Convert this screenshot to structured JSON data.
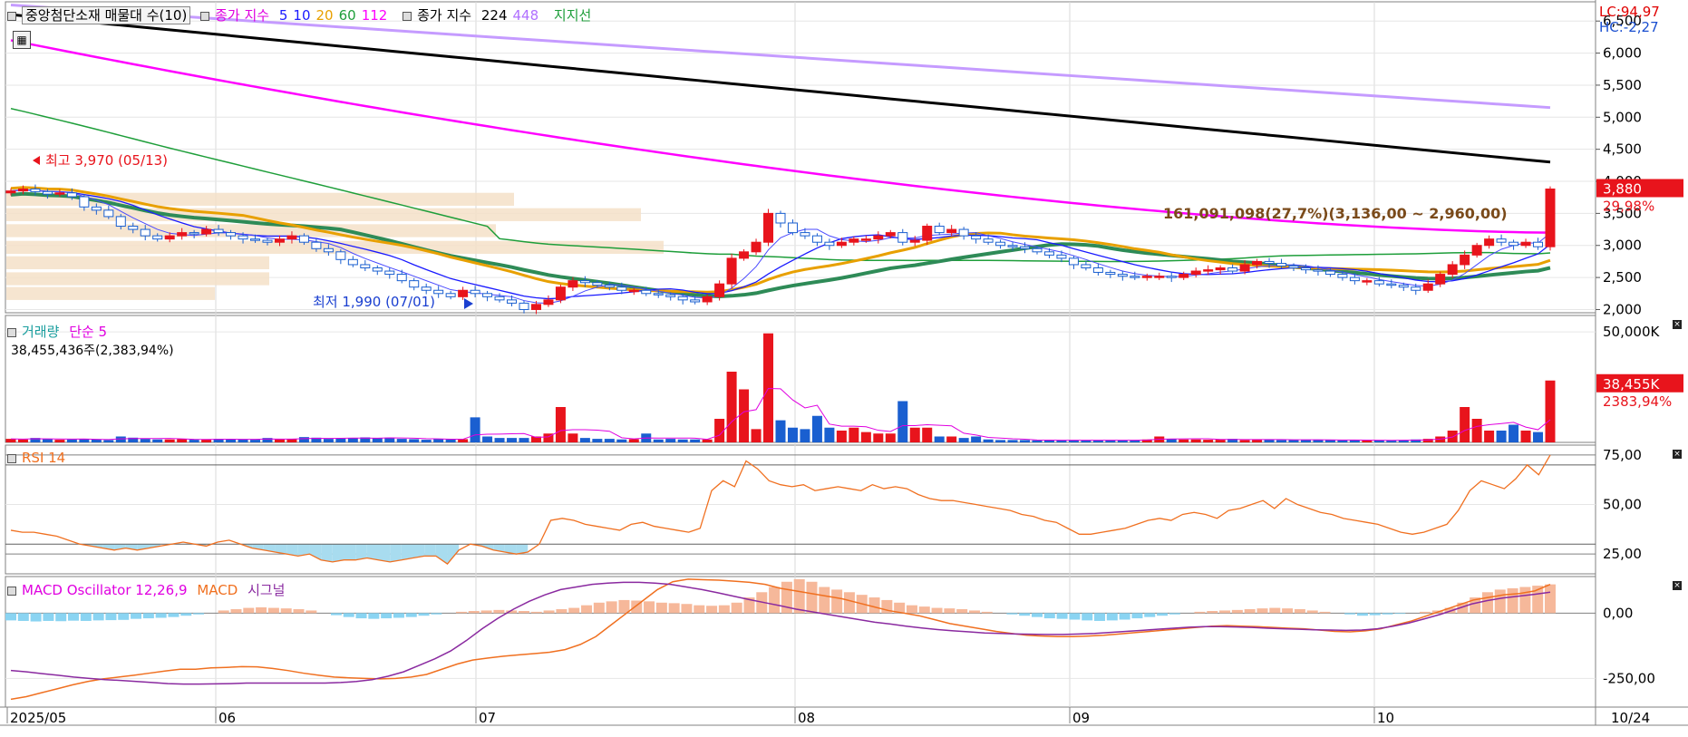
{
  "main_legend": {
    "title": "중앙첨단소재 매물대 수(10)",
    "ma_label": "종가 지수",
    "ma_periods": [
      "5",
      "10",
      "20",
      "60",
      "112"
    ],
    "ma_colors": [
      "#1a1aff",
      "#1a1aff",
      "#e8a000",
      "#1e9e3a",
      "#ff00ff"
    ],
    "ma2_label": "종가 지수",
    "ma2_periods": [
      "224",
      "448"
    ],
    "ma2_colors": [
      "#000000",
      "#b070ff"
    ],
    "support_label": "지지선",
    "lc": "LC:94,97",
    "hc": "HC:-2,27"
  },
  "volume_legend": {
    "label": "거래량",
    "ma_label": "단순 5",
    "value": "38,455,436주(2,383,94%)"
  },
  "rsi_legend": {
    "label": "RSI 14"
  },
  "macd_legend": {
    "osc": "MACD Oscillator 12,26,9",
    "macd": "MACD",
    "signal": "시그널"
  },
  "price_tag": {
    "price": "3,880",
    "pct": "29,98%"
  },
  "volume_tag": {
    "value": "38,455K",
    "pct": "2383,94%"
  },
  "annotations": {
    "high": "최고 3,970 (05/13)",
    "low": "최저 1,990 (07/01)",
    "range_note": "161,091,098(27,7%)(3,136,00 ~ 2,960,00)"
  },
  "x_labels": [
    "2025/05",
    "06",
    "07",
    "08",
    "09",
    "10",
    "10/24"
  ],
  "chart_data": [
    {
      "type": "candlestick",
      "panel": "price",
      "ylim": [
        1950,
        6800
      ],
      "yticks": [
        "2,000",
        "2,500",
        "3,000",
        "3,500",
        "4,000",
        "4,500",
        "5,000",
        "5,500",
        "6,000",
        "6,500"
      ],
      "ytick_values": [
        2000,
        2500,
        3000,
        3500,
        4000,
        4500,
        5000,
        5500,
        6000,
        6500
      ],
      "closes": [
        3850,
        3880,
        3840,
        3800,
        3820,
        3760,
        3600,
        3550,
        3450,
        3300,
        3250,
        3150,
        3100,
        3150,
        3200,
        3180,
        3250,
        3200,
        3150,
        3100,
        3080,
        3050,
        3100,
        3150,
        3050,
        2950,
        2900,
        2780,
        2700,
        2650,
        2600,
        2550,
        2450,
        2350,
        2300,
        2250,
        2200,
        2300,
        2250,
        2200,
        2150,
        2100,
        2000,
        2080,
        2150,
        2350,
        2450,
        2420,
        2380,
        2350,
        2300,
        2300,
        2250,
        2230,
        2200,
        2150,
        2120,
        2200,
        2400,
        2800,
        2900,
        3050,
        3500,
        3350,
        3200,
        3150,
        3050,
        3000,
        3050,
        3100,
        3100,
        3150,
        3200,
        3050,
        3080,
        3300,
        3200,
        3250,
        3150,
        3100,
        3050,
        3000,
        2980,
        2950,
        2900,
        2850,
        2800,
        2700,
        2650,
        2580,
        2550,
        2520,
        2500,
        2520,
        2520,
        2500,
        2550,
        2600,
        2620,
        2650,
        2600,
        2700,
        2750,
        2720,
        2680,
        2650,
        2620,
        2600,
        2550,
        2500,
        2450,
        2450,
        2400,
        2380,
        2350,
        2300,
        2400,
        2550,
        2700,
        2850,
        3000,
        3100,
        3050,
        3000,
        3050,
        2980,
        3880
      ],
      "volume_k": [
        1.2,
        1.0,
        1.5,
        1.1,
        0.9,
        1.0,
        1.2,
        1.0,
        0.8,
        2.0,
        1.6,
        1.2,
        1.0,
        1.0,
        1.1,
        0.9,
        1.0,
        1.2,
        1.1,
        1.0,
        0.9,
        1.5,
        1.0,
        1.1,
        1.8,
        1.6,
        1.2,
        1.3,
        1.5,
        1.7,
        1.5,
        1.6,
        1.2,
        1.1,
        0.9,
        1.2,
        1.0,
        1.1,
        8.5,
        2.0,
        1.5,
        1.5,
        1.5,
        2.0,
        3.0,
        12.0,
        3.0,
        1.5,
        1.2,
        1.2,
        1.0,
        1.1,
        3.0,
        1.0,
        1.2,
        1.0,
        1.0,
        1.0,
        8.0,
        24.0,
        18.0,
        4.5,
        37.0,
        7.5,
        5.0,
        4.5,
        9.0,
        5.0,
        4.0,
        5.0,
        3.5,
        3.0,
        3.0,
        14.0,
        5.0,
        5.0,
        2.0,
        2.0,
        1.5,
        2.0,
        1.0,
        0.8,
        0.8,
        0.8,
        0.7,
        0.7,
        0.7,
        0.8,
        0.7,
        0.7,
        0.8,
        0.7,
        0.8,
        1.0,
        2.0,
        1.2,
        1.0,
        1.0,
        0.9,
        0.9,
        1.2,
        0.8,
        1.0,
        1.0,
        0.8,
        0.9,
        0.8,
        0.9,
        0.8,
        0.7,
        0.8,
        0.7,
        0.7,
        0.6,
        0.8,
        1.0,
        1.2,
        2.0,
        4.0,
        12.0,
        8.0,
        4.0,
        4.0,
        6.0,
        4.0,
        3.5,
        21.0
      ],
      "ma224": [
        6600,
        4300
      ],
      "ma448": [
        6750,
        5150
      ],
      "ma112": [
        6200,
        3200
      ]
    },
    {
      "type": "bar",
      "panel": "volume",
      "yticks": [
        "50,000K"
      ],
      "ytick_values": [
        50000
      ]
    },
    {
      "type": "line",
      "panel": "rsi",
      "ylim": [
        15,
        80
      ],
      "yticks": [
        "25,00",
        "50,00",
        "75,00"
      ],
      "ytick_values": [
        25,
        50,
        75
      ],
      "values": [
        37,
        36,
        36,
        35,
        34,
        32,
        30,
        29,
        28,
        27,
        28,
        27,
        28,
        29,
        30,
        31,
        30,
        29,
        31,
        32,
        30,
        28,
        27,
        26,
        25,
        24,
        25,
        22,
        21,
        22,
        22,
        23,
        22,
        21,
        22,
        23,
        24,
        24,
        20,
        27,
        30,
        29,
        27,
        26,
        25,
        26,
        30,
        42,
        43,
        42,
        40,
        39,
        38,
        37,
        40,
        41,
        39,
        38,
        37,
        36,
        38,
        57,
        62,
        59,
        72,
        68,
        62,
        60,
        59,
        60,
        57,
        58,
        59,
        58,
        57,
        60,
        58,
        59,
        58,
        55,
        53,
        52,
        52,
        51,
        50,
        49,
        48,
        47,
        45,
        44,
        42,
        41,
        38,
        35,
        35,
        36,
        37,
        38,
        40,
        42,
        43,
        42,
        45,
        46,
        45,
        43,
        47,
        48,
        50,
        52,
        48,
        53,
        50,
        48,
        46,
        45,
        43,
        42,
        41,
        40,
        38,
        36,
        35,
        36,
        38,
        40,
        47,
        57,
        62,
        60,
        58,
        63,
        70,
        65,
        75
      ]
    },
    {
      "type": "bar",
      "panel": "macd",
      "ylim": [
        -360,
        140
      ],
      "yticks": [
        "-250,00",
        "0,00"
      ],
      "ytick_values": [
        -250,
        0
      ],
      "oscillator": [
        -28,
        -30,
        -32,
        -30,
        -31,
        -29,
        -30,
        -28,
        -27,
        -26,
        -22,
        -20,
        -18,
        -15,
        -10,
        -5,
        0,
        10,
        15,
        20,
        22,
        20,
        18,
        15,
        10,
        0,
        -8,
        -15,
        -20,
        -22,
        -20,
        -18,
        -15,
        -10,
        -5,
        0,
        5,
        8,
        10,
        12,
        10,
        8,
        5,
        10,
        15,
        20,
        30,
        40,
        45,
        50,
        48,
        45,
        40,
        38,
        35,
        30,
        28,
        30,
        40,
        60,
        80,
        100,
        120,
        130,
        120,
        100,
        90,
        80,
        70,
        60,
        50,
        40,
        30,
        25,
        20,
        18,
        15,
        10,
        5,
        0,
        -5,
        -10,
        -15,
        -20,
        -22,
        -25,
        -28,
        -30,
        -28,
        -25,
        -20,
        -15,
        -10,
        -5,
        0,
        5,
        8,
        10,
        12,
        15,
        18,
        20,
        18,
        15,
        10,
        5,
        0,
        -5,
        -10,
        -8,
        -5,
        -3,
        0,
        5,
        10,
        20,
        40,
        60,
        80,
        90,
        95,
        100,
        105,
        110
      ],
      "macd": [
        -330,
        -320,
        -305,
        -290,
        -275,
        -262,
        -252,
        -245,
        -238,
        -230,
        -222,
        -215,
        -215,
        -210,
        -208,
        -205,
        -206,
        -212,
        -220,
        -230,
        -238,
        -245,
        -248,
        -250,
        -252,
        -250,
        -245,
        -235,
        -215,
        -195,
        -180,
        -172,
        -165,
        -160,
        -155,
        -150,
        -140,
        -120,
        -90,
        -45,
        0,
        45,
        90,
        120,
        130,
        128,
        126,
        122,
        118,
        110,
        95,
        85,
        75,
        65,
        55,
        40,
        25,
        10,
        0,
        -10,
        -25,
        -40,
        -50,
        -60,
        -70,
        -78,
        -85,
        -88,
        -90,
        -90,
        -88,
        -85,
        -80,
        -75,
        -70,
        -65,
        -60,
        -55,
        -50,
        -48,
        -50,
        -52,
        -55,
        -58,
        -60,
        -65,
        -70,
        -72,
        -68,
        -60,
        -45,
        -30,
        -10,
        10,
        30,
        50,
        60,
        70,
        75,
        85,
        110
      ],
      "signal": [
        -220,
        -225,
        -232,
        -238,
        -245,
        -250,
        -255,
        -258,
        -262,
        -266,
        -270,
        -272,
        -272,
        -271,
        -270,
        -268,
        -268,
        -268,
        -268,
        -268,
        -268,
        -266,
        -262,
        -255,
        -242,
        -225,
        -200,
        -175,
        -145,
        -105,
        -60,
        -20,
        15,
        45,
        70,
        90,
        100,
        110,
        115,
        118,
        118,
        115,
        110,
        100,
        90,
        78,
        65,
        52,
        40,
        28,
        15,
        5,
        -5,
        -15,
        -25,
        -35,
        -42,
        -50,
        -57,
        -63,
        -68,
        -72,
        -76,
        -78,
        -80,
        -81,
        -82,
        -82,
        -80,
        -78,
        -74,
        -70,
        -66,
        -62,
        -58,
        -54,
        -52,
        -52,
        -53,
        -55,
        -58,
        -60,
        -62,
        -64,
        -65,
        -66,
        -65,
        -60,
        -50,
        -38,
        -22,
        -5,
        15,
        35,
        48,
        58,
        65,
        72,
        80
      ]
    }
  ]
}
